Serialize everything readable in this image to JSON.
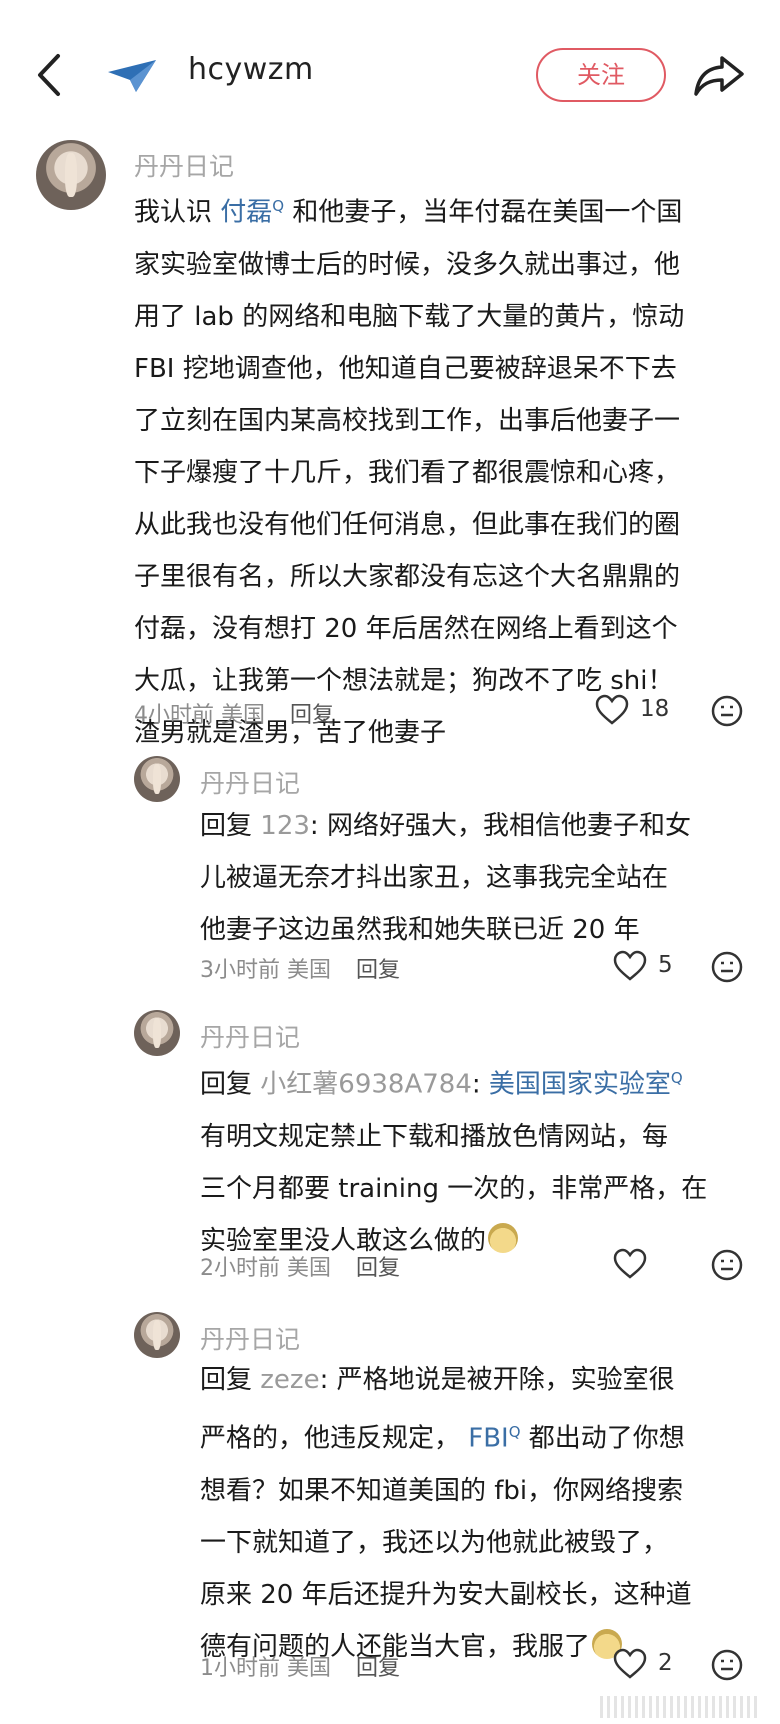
{
  "header": {
    "username": "hcywzm",
    "follow_label": "关注"
  },
  "icons": {
    "back": "chevron-left-icon",
    "logo": "paper-plane-icon",
    "share": "share-arrow-icon"
  },
  "comments": [
    {
      "author": "丹丹日记",
      "text_lines": [
        "我认识 付磊 和他妻子，当年付磊在美国一个国",
        "家实验室做博士后的时候，没多久就出事过，他",
        "用了 lab 的网络和电脑下载了大量的黄片，惊动",
        "FBI 挖地调查他，他知道自己要被辞退呆不下去",
        "了立刻在国内某高校找到工作，出事后他妻子一",
        "下子爆瘦了十几斤，我们看了都很震惊和心疼，",
        "从此我也没有他们任何消息，但此事在我们的圈",
        "子里很有名，所以大家都没有忘这个大名鼎鼎的",
        "付磊，没有想打 20 年后居然在网络上看到这个",
        "大瓜，让我第一个想法就是；狗改不了吃 shi！",
        "渣男就是渣男，苦了他妻子"
      ],
      "link_word": "付磊",
      "time": "4小时前",
      "location": "美国",
      "reply_label": "回复",
      "likes": "18"
    },
    {
      "author": "丹丹日记",
      "reply_prefix": "回复",
      "reply_to": "123",
      "text_lines": [
        "回复 123: 网络好强大，我相信他妻子和女",
        "儿被逼无奈才抖出家丑，这事我完全站在",
        "他妻子这边虽然我和她失联已近 20 年"
      ],
      "time": "3小时前",
      "location": "美国",
      "reply_label": "回复",
      "likes": "5"
    },
    {
      "author": "丹丹日记",
      "reply_prefix": "回复",
      "reply_to": "小红薯6938A784",
      "link_word": "美国国家实验室",
      "text_lines": [
        "回复 小红薯6938A784: 美国国家实验室",
        "有明文规定禁止下载和播放色情网站，每",
        "三个月都要 training 一次的，非常严格，在",
        "实验室里没人敢这么做的"
      ],
      "time": "2小时前",
      "location": "美国",
      "reply_label": "回复",
      "likes": ""
    },
    {
      "author": "丹丹日记",
      "reply_prefix": "回复",
      "reply_to": "zeze",
      "link_word": "FBI",
      "text_lines": [
        "回复 zeze: 严格地说是被开除，实验室很",
        "严格的，他违反规定， FBI 都出动了你想",
        "想看？如果不知道美国的 fbi，你网络搜索",
        "一下就知道了，我还以为他就此被毁了，",
        "原来 20 年后还提升为安大副校长，这种道",
        "德有问题的人还能当大官，我服了"
      ],
      "time": "1小时前",
      "location": "美国",
      "reply_label": "回复",
      "likes": "2"
    }
  ]
}
